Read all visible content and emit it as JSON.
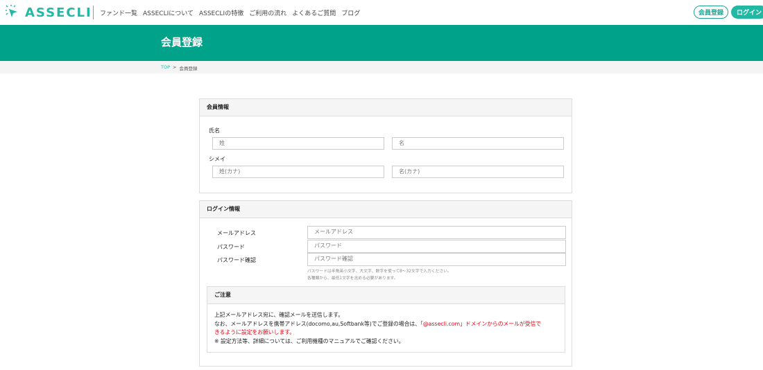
{
  "brand": {
    "name": "ASSECLI",
    "color": "#23b8a3"
  },
  "nav": {
    "items": [
      "ファンド一覧",
      "ASSECLIについて",
      "ASSECLIの特徴",
      "ご利用の流れ",
      "よくあるご質問",
      "ブログ"
    ]
  },
  "header": {
    "register_label": "会員登録",
    "login_label": "ログイン"
  },
  "page": {
    "title": "会員登録"
  },
  "breadcrumb": {
    "top": "TOP",
    "sep": ">",
    "current": "会員登録"
  },
  "member_info": {
    "heading": "会員情報",
    "name_label": "氏名",
    "last_name_placeholder": "姓",
    "first_name_placeholder": "名",
    "kana_label": "シメイ",
    "last_kana_placeholder": "姓(カナ)",
    "first_kana_placeholder": "名(カナ)"
  },
  "login_info": {
    "heading": "ログイン情報",
    "email_label": "メールアドレス",
    "email_placeholder": "メールアドレス",
    "password_label": "パスワード",
    "password_placeholder": "パスワード",
    "password_confirm_label": "パスワード確認",
    "password_confirm_placeholder": "パスワード確認",
    "hint_line1": "パスワードは半角英小文字、大文字、数字を使って8〜32文字で入力ください。",
    "hint_line2": "各種類から、最低1文字を含める必要があります。"
  },
  "notice": {
    "heading": "ご注意",
    "line1": "上記メールアドレス宛に、確認メールを送信します。",
    "line2_pre": "なお、メールアドレスを携帯アドレス(docomo,au,Softbank等)でご登録の場合は、",
    "line2_red": "「@assecli.com」ドメインからのメールが受信で",
    "line3_red": "きるように設定をお願いします。",
    "line4": "※ 設定方法等、詳細については、ご利用機種のマニュアルでご確認ください。"
  }
}
